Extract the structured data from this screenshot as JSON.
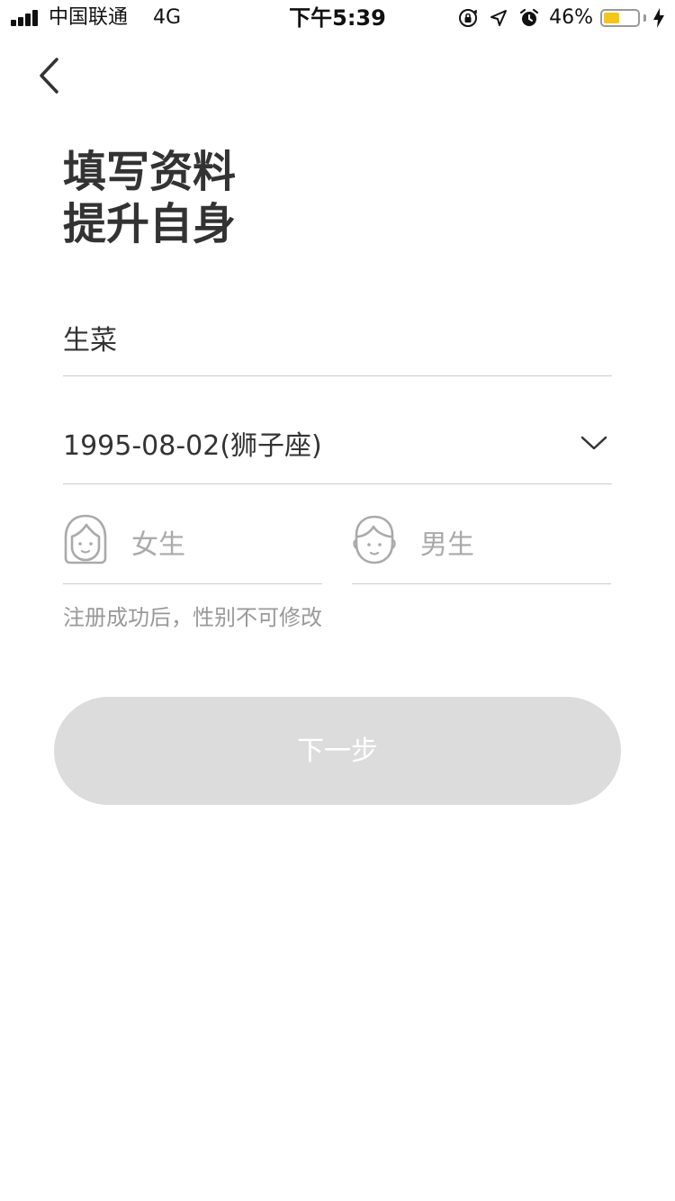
{
  "status_bar": {
    "carrier": "中国联通",
    "network": "4G",
    "time": "下午5:39",
    "icons": [
      "orientation-lock-icon",
      "location-arrow-icon",
      "alarm-icon"
    ],
    "battery_percent": "46%",
    "battery_level": 0.46,
    "battery_color": "#f5c518",
    "charging_icon": "bolt-icon"
  },
  "header": {
    "back_icon": "chevron-left-icon"
  },
  "title": {
    "line1": "填写资料",
    "line2": "提升自身"
  },
  "form": {
    "nickname_value": "生菜",
    "birthday_value": "1995-08-02(狮子座)",
    "gender_options": [
      {
        "label": "女生",
        "icon": "female-avatar-icon"
      },
      {
        "label": "男生",
        "icon": "male-avatar-icon"
      }
    ],
    "gender_hint": "注册成功后，性别不可修改"
  },
  "actions": {
    "next_label": "下一步",
    "next_bg": "#dcdcdc"
  }
}
